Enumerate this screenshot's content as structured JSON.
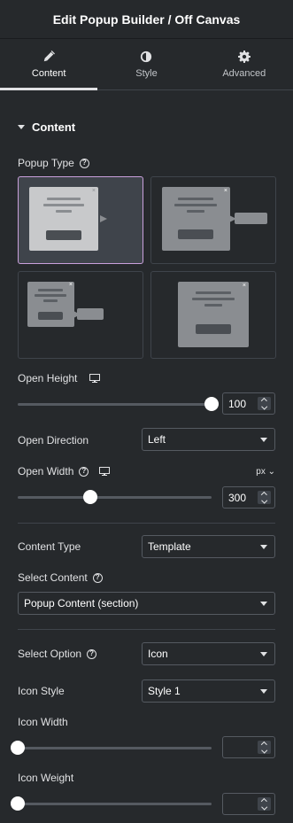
{
  "header": {
    "title": "Edit Popup Builder / Off Canvas"
  },
  "tabs": [
    {
      "label": "Content",
      "icon": "pencil-icon"
    },
    {
      "label": "Style",
      "icon": "contrast-icon"
    },
    {
      "label": "Advanced",
      "icon": "gear-icon"
    }
  ],
  "section": {
    "title": "Content"
  },
  "popup_type": {
    "label": "Popup Type",
    "selected": 0
  },
  "open_height": {
    "label": "Open Height",
    "value": "100",
    "level": 1.0
  },
  "open_direction": {
    "label": "Open Direction",
    "value": "Left"
  },
  "open_width": {
    "label": "Open Width",
    "unit": "px",
    "value": "300",
    "level": 0.3
  },
  "content_type": {
    "label": "Content Type",
    "value": "Template"
  },
  "select_content": {
    "label": "Select Content",
    "value": "Popup Content (section)"
  },
  "select_option": {
    "label": "Select Option",
    "value": "Icon"
  },
  "icon_style": {
    "label": "Icon Style",
    "value": "Style 1"
  },
  "icon_width": {
    "label": "Icon Width",
    "value": "",
    "level": 0
  },
  "icon_weight": {
    "label": "Icon Weight",
    "value": "",
    "level": 0
  },
  "colors": {
    "accent": "#c9a0dc",
    "panel": "#26292c"
  }
}
